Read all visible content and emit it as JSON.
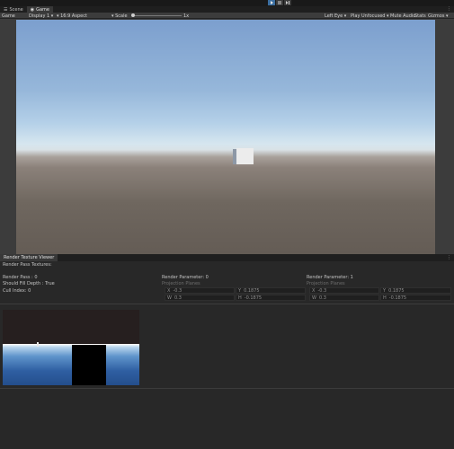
{
  "toolbar": {
    "play_icons": [
      "play-icon",
      "pause-icon",
      "step-icon"
    ]
  },
  "tabs": [
    {
      "label": "Scene",
      "icon": "scene-icon"
    },
    {
      "label": "Game",
      "icon": "game-icon"
    }
  ],
  "game_toolbar": {
    "mode": "Game",
    "display": "Display 1",
    "aspect": "16:9 Aspect",
    "scale_label": "Scale",
    "scale_value": "1x",
    "eye": "Left Eye",
    "play_mode": "Play Unfocused",
    "mute": "Mute Audio",
    "stats": "Stats",
    "gizmos": "Gizmos",
    "scale_level": 0.0
  },
  "viewer": {
    "tab_label": "Render Texture Viewer",
    "section_title": "Render Pass Textures:",
    "render_pass": "Render Pass : 0",
    "fill_depth": "Should Fill Depth : True",
    "cull_index": "Cull Index: 0",
    "params": [
      {
        "title": "Render Parameter: 0",
        "sub": "Projection Planes",
        "x_label": "X",
        "x_value": "-0.3",
        "y_label": "Y",
        "y_value": "0.1875",
        "w_label": "W",
        "w_value": "0.3",
        "h_label": "H",
        "h_value": "-0.1875"
      },
      {
        "title": "Render Parameter: 1",
        "sub": "Projection Planes",
        "x_label": "X",
        "x_value": "-0.3",
        "y_label": "Y",
        "y_value": "0.1875",
        "w_label": "W",
        "w_value": "0.3",
        "h_label": "H",
        "h_value": "-0.1875"
      }
    ]
  },
  "colors": {
    "sky_top": "#7c9fce",
    "horizon": "#d6e6ef",
    "ground": "#645c55",
    "accent": "#3b6ea0"
  }
}
